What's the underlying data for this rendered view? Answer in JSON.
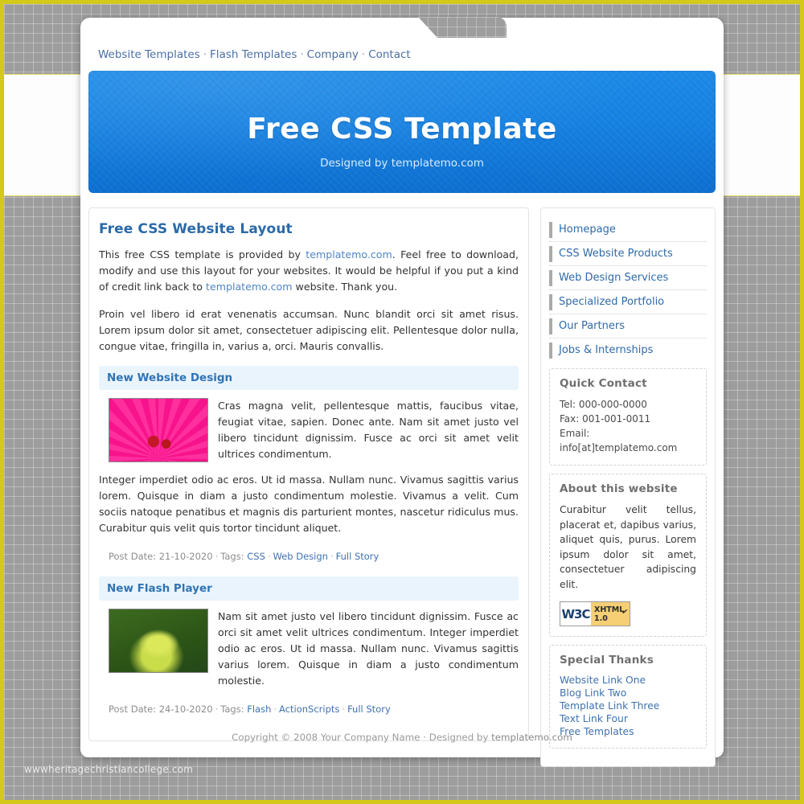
{
  "background": {
    "watermark_text": "wwwheritagechristiancollege.com",
    "frame_color": "#d4c81a",
    "pattern_color": "#9d9d9d"
  },
  "topnav": {
    "items": [
      {
        "label": "Website Templates"
      },
      {
        "label": "Flash Templates"
      },
      {
        "label": "Company"
      },
      {
        "label": "Contact"
      }
    ],
    "separator": "·"
  },
  "banner": {
    "title": "Free CSS Template",
    "tagline": "Designed by templatemo.com",
    "accent_color": "#1581e2"
  },
  "main": {
    "title": "Free CSS Website Layout",
    "intro_1_a": "This free CSS template is provided by ",
    "intro_1_link1": "templatemo.com",
    "intro_1_b": ". Feel free to download, modify and use this layout for your websites. It would be helpful if you put a kind of credit link back to ",
    "intro_1_link2": "templatemo.com",
    "intro_1_c": " website. Thank you.",
    "intro_2": "Proin vel libero id erat venenatis accumsan. Nunc blandit orci sit amet risus. Lorem ipsum dolor sit amet, consectetuer adipiscing elit. Pellentesque dolor nulla, congue vitae, fringilla in, varius a, orci. Mauris convallis.",
    "posts": [
      {
        "heading": "New Website Design",
        "thumb_name": "pink-flower-thumbnail",
        "paragraph_1": "Cras magna velit, pellentesque mattis, faucibus vitae, feugiat vitae, sapien. Donec ante. Nam sit amet justo vel libero tincidunt dignissim. Fusce ac orci sit amet velit ultrices condimentum.",
        "paragraph_2": "Integer imperdiet odio ac eros. Ut id massa. Nullam nunc. Vivamus sagittis varius lorem. Quisque in diam a justo condimentum molestie. Vivamus a velit. Cum sociis natoque penatibus et magnis dis parturient montes, nascetur ridiculus mus. Curabitur quis velit quis tortor tincidunt aliquet.",
        "post_date_label": "Post Date:",
        "post_date": "21-10-2020",
        "tags_label": "Tags:",
        "tags": [
          "CSS",
          "Web Design",
          "Full Story"
        ]
      },
      {
        "heading": "New Flash Player",
        "thumb_name": "green-plant-thumbnail",
        "paragraph_1": "Nam sit amet justo vel libero tincidunt dignissim. Fusce ac orci sit amet velit ultrices condimentum. Integer imperdiet odio ac eros. Ut id massa. Nullam nunc. Vivamus sagittis varius lorem. Quisque in diam a justo condimentum molestie.",
        "paragraph_2": "",
        "post_date_label": "Post Date:",
        "post_date": "24-10-2020",
        "tags_label": "Tags:",
        "tags": [
          "Flash",
          "ActionScripts",
          "Full Story"
        ]
      }
    ]
  },
  "sidebar": {
    "nav": [
      {
        "label": "Homepage"
      },
      {
        "label": "CSS Website Products"
      },
      {
        "label": "Web Design Services"
      },
      {
        "label": "Specialized Portfolio"
      },
      {
        "label": "Our Partners"
      },
      {
        "label": "Jobs & Internships"
      }
    ],
    "quick_contact": {
      "title": "Quick Contact",
      "tel": "Tel: 000-000-0000",
      "fax": "Fax: 001-001-0011",
      "email": "Email: info[at]templatemo.com"
    },
    "about": {
      "title": "About this website",
      "text": "Curabitur velit tellus, placerat et, dapibus varius, aliquet quis, purus. Lorem ipsum dolor sit amet, consectetuer adipiscing elit.",
      "badge": {
        "left": "W3C",
        "line1": "XHTML",
        "line2": "1.0",
        "check": "✔"
      }
    },
    "special_thanks": {
      "title": "Special Thanks",
      "links": [
        {
          "label": "Website Link One"
        },
        {
          "label": "Blog Link Two"
        },
        {
          "label": "Template Link Three"
        },
        {
          "label": "Text Link Four"
        },
        {
          "label": "Free Templates"
        }
      ]
    }
  },
  "footer": {
    "copyright": "Copyright © 2008 Your Company Name",
    "separator": "·",
    "designed_label": "Designed by ",
    "designed_link": "templatemo.com"
  }
}
